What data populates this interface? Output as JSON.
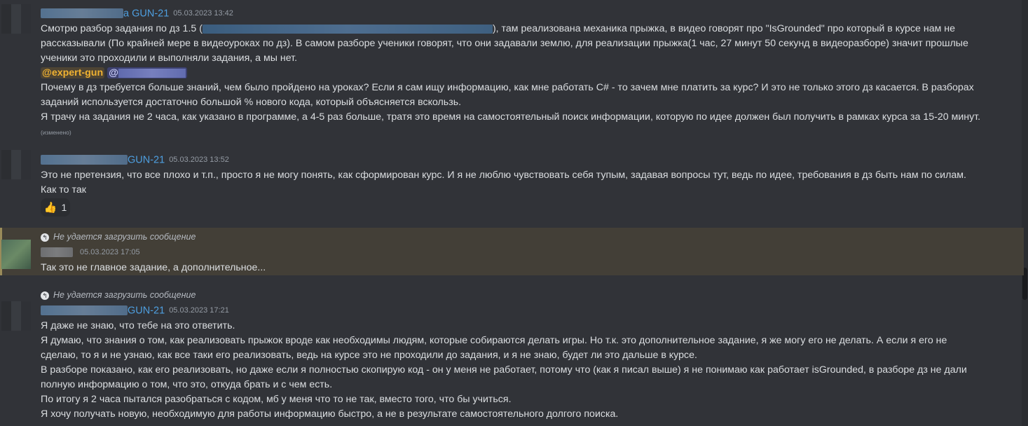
{
  "messages": [
    {
      "author_suffix": "a GUN-21",
      "timestamp": "05.03.2023 13:42",
      "lines": [
        {
          "before": "Смотрю разбор задания по дз 1.5 (",
          "after": "), там реализована механика прыжка, в видео говорят про \"IsGrounded\" про который в курсе нам не"
        },
        "рассказывали (По крайней мере в видеоуроках по дз). В самом разборе ученики говорят, что они задавали землю, для реализации прыжка(1 час, 27 минут 50 секунд в видеоразборе) значит прошлые",
        "ученики это проходили и выполняли задания, а мы нет.",
        "Почему в дз требуется больше знаний, чем было пройдено на уроках? Если я сам ищу информацию, как мне работать C# - то зачем мне платить за курс? И это не только этого дз касается. В разборах",
        "заданий используется достаточно большой % нового кода, который объясняется вскользь.",
        "Я трачу на задания не 2 часа, как указано в программе, а 4-5 раз больше, тратя это время на самостоятельный поиск информации, которую по идее должен был получить в рамках курса за 15-20 минут."
      ],
      "mention_primary": "@expert-gun",
      "mention_secondary": "@",
      "edited": "(изменено)"
    },
    {
      "author_suffix": "GUN-21",
      "timestamp": "05.03.2023 13:52",
      "lines": [
        "Это не претензия, что все плохо и т.п., просто я не могу понять, как сформирован курс. И я не люблю чувствовать себя тупым, задавая вопросы тут, ведь по идее, требования в дз быть нам по силам.",
        "Как то так"
      ],
      "reaction_count": "1"
    },
    {
      "reply_text": "Не удается загрузить сообщение",
      "timestamp": "05.03.2023 17:05",
      "lines": [
        "Так это не главное задание, а дополнительное..."
      ]
    },
    {
      "reply_text": "Не удается загрузить сообщение",
      "author_suffix": "GUN-21",
      "timestamp": "05.03.2023 17:21",
      "lines": [
        "Я даже не знаю, что тебе на это ответить.",
        "Я думаю, что знания о том, как реализовать прыжок вроде как необходимы людям, которые собираются делать игры. Но т.к. это дополнительное задание, я же могу его не делать. А если я его не",
        "сделаю, то я и не узнаю, как все таки его реализовать, ведь на курсе это не проходили до задания, и я не знаю, будет ли это дальше в курсе.",
        "В разборе показано, как его реализовать, но даже если я полностью скопирую код - он у меня не работает, потому что (как я писал выше) я не понимаю как работает isGrounded, в разборе дз не дали",
        "полную информацию о том, что это, откуда брать и с чем есть.",
        "По итогу я 2 часа пытался разобраться с кодом, мб у меня что то не так, вместо того, что бы учиться.",
        "Я хочу получать новую, необходимую для работы информацию быстро, а не в результате самостоятельного долгого поиска."
      ]
    }
  ]
}
